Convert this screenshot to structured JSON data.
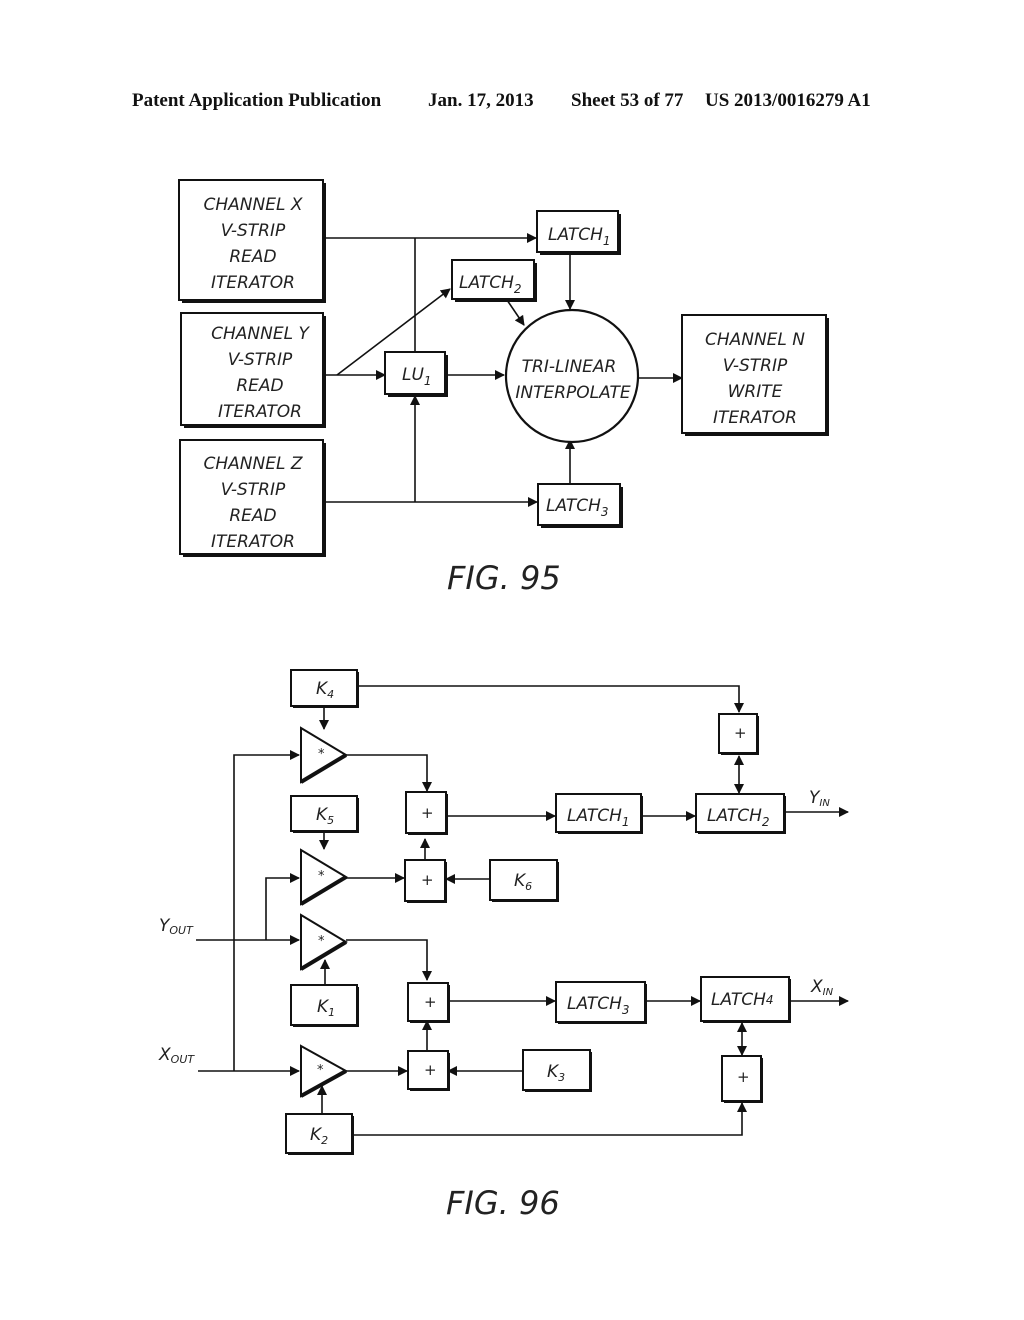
{
  "header": {
    "publication": "Patent Application Publication",
    "date": "Jan. 17, 2013",
    "sheet": "Sheet 53 of 77",
    "number": "US 2013/0016279 A1"
  },
  "fig95": {
    "caption": "FIG. 95",
    "channel_x": [
      "CHANNEL X",
      "V-STRIP",
      "READ",
      "ITERATOR"
    ],
    "channel_y": [
      "CHANNEL Y",
      "V-STRIP",
      "READ",
      "ITERATOR"
    ],
    "channel_z": [
      "CHANNEL Z",
      "V-STRIP",
      "READ",
      "ITERATOR"
    ],
    "channel_n": [
      "CHANNEL N",
      "V-STRIP",
      "WRITE",
      "ITERATOR"
    ],
    "latch1": {
      "base": "LATCH",
      "sub": "1"
    },
    "latch2": {
      "base": "LATCH",
      "sub": "2"
    },
    "latch3": {
      "base": "LATCH",
      "sub": "3"
    },
    "lu1": {
      "base": "LU",
      "sub": "1"
    },
    "interpolate": [
      "TRI-LINEAR",
      "INTERPOLATE"
    ]
  },
  "fig96": {
    "caption": "FIG. 96",
    "k1": {
      "base": "K",
      "sub": "1"
    },
    "k2": {
      "base": "K",
      "sub": "2"
    },
    "k3": {
      "base": "K",
      "sub": "3"
    },
    "k4": {
      "base": "K",
      "sub": "4"
    },
    "k5": {
      "base": "K",
      "sub": "5"
    },
    "k6": {
      "base": "K",
      "sub": "6"
    },
    "latch1": {
      "base": "LATCH",
      "sub": "1"
    },
    "latch2": {
      "base": "LATCH",
      "sub": "2"
    },
    "latch3": {
      "base": "LATCH",
      "sub": "3"
    },
    "latch4": {
      "base": "LATCH",
      "sub": "4"
    },
    "plus": "+",
    "mult": "*",
    "y_out": {
      "base": "Y",
      "sub": "OUT"
    },
    "x_out": {
      "base": "X",
      "sub": "OUT"
    },
    "y_in": {
      "base": "Y",
      "sub": "IN"
    },
    "x_in": {
      "base": "X",
      "sub": "IN"
    }
  }
}
